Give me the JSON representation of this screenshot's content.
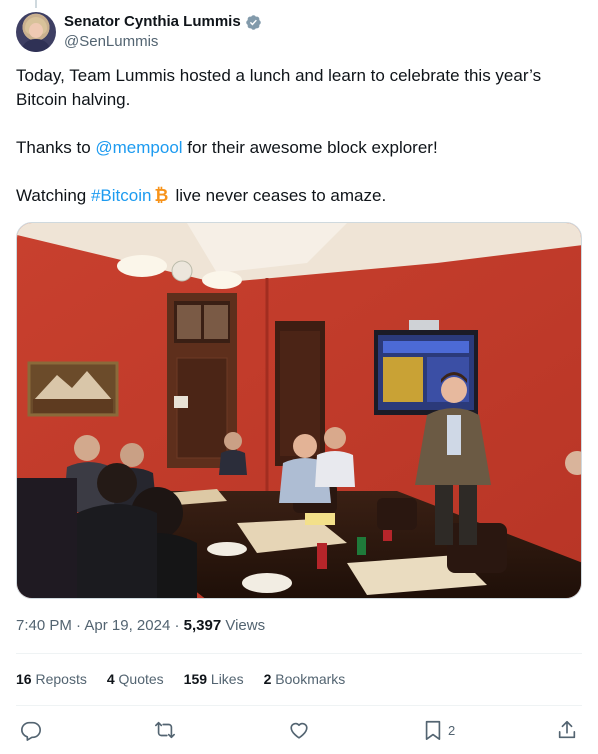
{
  "author": {
    "display_name": "Senator Cynthia Lummis",
    "handle": "@SenLummis",
    "verified_color": "#829aab"
  },
  "tweet": {
    "line1": "Today, Team Lummis hosted a lunch and learn to celebrate this year’s Bitcoin halving.",
    "line2_prefix": "Thanks to ",
    "line2_mention": "@mempool",
    "line2_suffix": " for their awesome block explorer!",
    "line3_prefix": "Watching ",
    "line3_hashtag": "#Bitcoin",
    "line3_suffix": "live never ceases to amaze.",
    "bitcoin_emoji_color": "#f7931a"
  },
  "meta": {
    "time": "7:40 PM",
    "sep1": " · ",
    "date": "Apr 19, 2024",
    "sep2": " · ",
    "views_count": "5,397",
    "views_label": " Views"
  },
  "stats": {
    "reposts_count": "16",
    "reposts_label": "Reposts",
    "quotes_count": "4",
    "quotes_label": "Quotes",
    "likes_count": "159",
    "likes_label": "Likes",
    "bookmarks_count": "2",
    "bookmarks_label": "Bookmarks"
  },
  "actions": {
    "reply_icon": "reply-icon",
    "repost_icon": "repost-icon",
    "like_icon": "like-icon",
    "bookmark_icon": "bookmark-icon",
    "bookmark_count": "2",
    "share_icon": "share-icon"
  },
  "colors": {
    "link": "#1d9bf0",
    "secondary_text": "#536471",
    "primary_text": "#0f1419"
  }
}
